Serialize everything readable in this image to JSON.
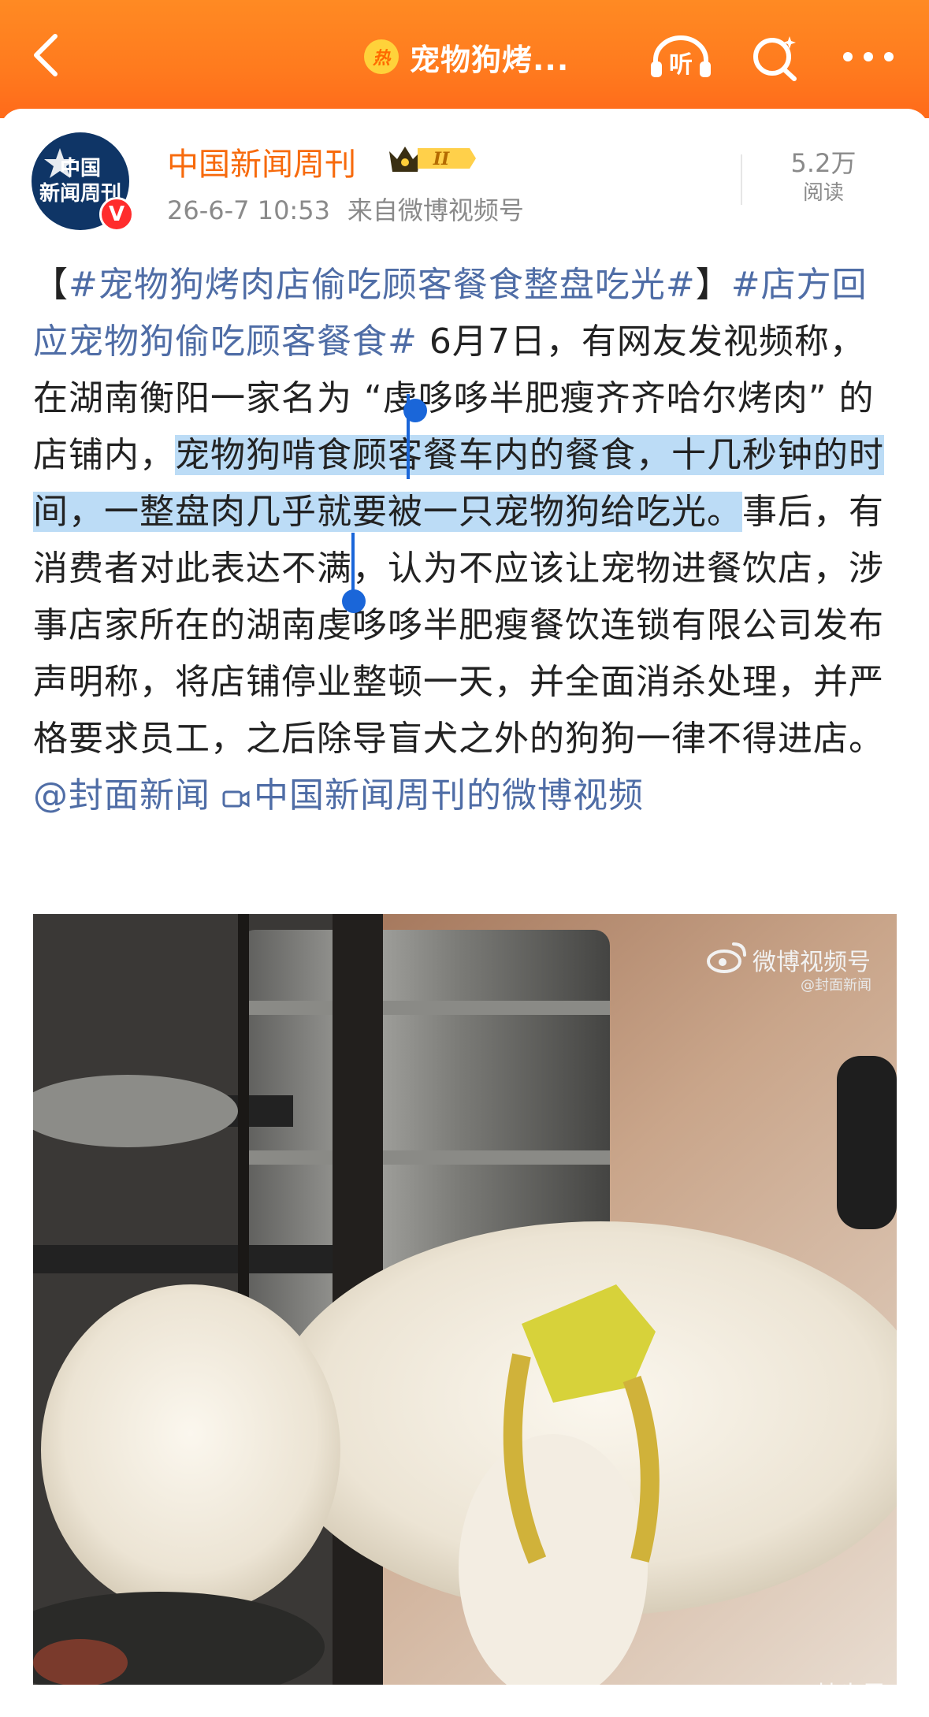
{
  "topbar": {
    "hot_label": "热",
    "title": "宠物狗烤...",
    "listen_label": "听"
  },
  "post": {
    "avatar_text": "中国\n新闻周刊",
    "verified_label": "V",
    "author": "中国新闻周刊",
    "level_label": "II",
    "date": "26-6-7 10:53",
    "source": "来自微博视频号",
    "reads_count": "5.2万",
    "reads_label": "阅读"
  },
  "content": {
    "part1": "【",
    "tag1": "#宠物狗烤肉店偷吃顾客餐食整盘吃光#",
    "part2": "】",
    "tag2": "#店方回应宠物狗偷吃顾客餐食#",
    "part3": " 6月7日，有网友发视频称，在湖南衡阳一家名为 “虔哆哆半肥瘦齐齐哈尔烤肉” 的店铺内，",
    "highlight": "宠物狗啃食顾客餐车内的餐食，十几秒钟的时间，一整盘肉几乎就要被一只宠物狗给吃光。",
    "part4": "事后，有消费者对此表达不满，认为不应该让宠物进餐饮店，涉事店家所在的湖南虔哆哆半肥瘦餐饮连锁有限公司发布声明称，将店铺停业整顿一天，并全面消杀处理，并严格要求员工，之后除导盲犬之外的狗狗一律不得进店。",
    "mention": "@封面新闻",
    "video_link": "中国新闻周刊的微博视频"
  },
  "video": {
    "watermark": "微博视频号",
    "watermark_sub": "@封面新闻",
    "signature": "@林步里"
  }
}
